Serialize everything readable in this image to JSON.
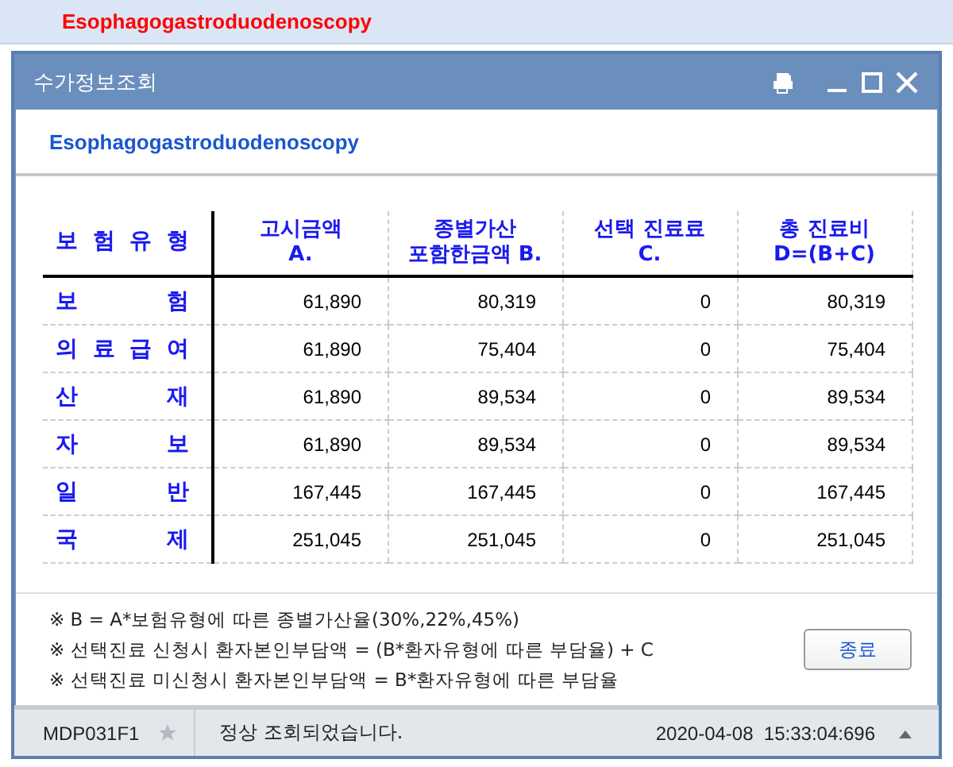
{
  "top_bar": {
    "title": "Esophagogastroduodenoscopy"
  },
  "window": {
    "title": "수가정보조회"
  },
  "procedure_name": "Esophagogastroduodenoscopy",
  "table": {
    "columns": [
      "보 험 유 형",
      "고시금액\nA.",
      "종별가산\n포함한금액 B.",
      "선택 진료료\nC.",
      "총 진료비\nD=(B+C)"
    ],
    "rows": [
      [
        "보 험",
        "61,890",
        "80,319",
        "0",
        "80,319"
      ],
      [
        "의 료 급 여",
        "61,890",
        "75,404",
        "0",
        "75,404"
      ],
      [
        "산 재",
        "61,890",
        "89,534",
        "0",
        "89,534"
      ],
      [
        "자 보",
        "61,890",
        "89,534",
        "0",
        "89,534"
      ],
      [
        "일 반",
        "167,445",
        "167,445",
        "0",
        "167,445"
      ],
      [
        "국 제",
        "251,045",
        "251,045",
        "0",
        "251,045"
      ]
    ]
  },
  "notes": [
    "※ B = A*보험유형에 따른 종별가산율(30%,22%,45%)",
    "※ 선택진료 신청시 환자본인부담액 = (B*환자유형에 따른 부담율) + C",
    "※ 선택진료 미신청시 환자본인부담액 = B*환자유형에 따른 부담율"
  ],
  "close_button": "종료",
  "status_bar": {
    "screen_id": "MDP031F1",
    "message": "정상 조회되었습니다.",
    "timestamp": "2020-04-08  15:33:04:696"
  }
}
